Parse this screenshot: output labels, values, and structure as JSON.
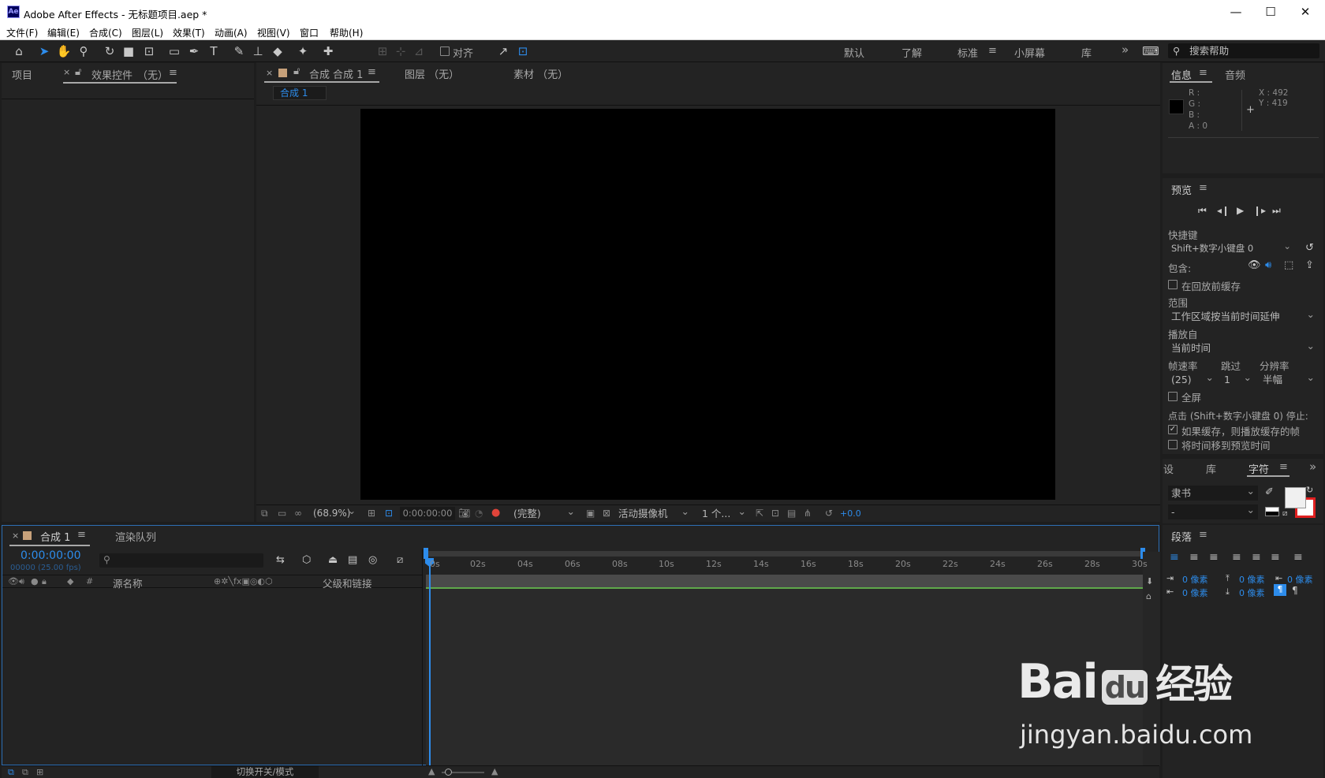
{
  "app": {
    "logo": "Ae",
    "title": "Adobe After Effects - 无标题项目.aep *"
  },
  "window_controls": {
    "minimize": "—",
    "maximize": "☐",
    "close": "✕"
  },
  "menu": [
    "文件(F)",
    "编辑(E)",
    "合成(C)",
    "图层(L)",
    "效果(T)",
    "动画(A)",
    "视图(V)",
    "窗口",
    "帮助(H)"
  ],
  "toolbar": {
    "align_label": "对齐",
    "workspaces": [
      "默认",
      "了解",
      "标准",
      "小屏幕",
      "库"
    ],
    "active_workspace": "标准",
    "more": "»",
    "search_placeholder": "搜索帮助"
  },
  "project_panel": {
    "tab_project": "项目",
    "tab_effects": "效果控件",
    "effects_target": "（无）"
  },
  "viewer": {
    "tab_comp_prefix": "合成",
    "tab_comp_name": "合成 1",
    "tab_layer": "图层 （无）",
    "tab_footage": "素材 （无）",
    "breadcrumb": "合成 1",
    "zoom": "(68.9%)",
    "timecode": "0:00:00:00",
    "resolution": "(完整)",
    "camera": "活动摄像机",
    "views": "1 个...",
    "exposure": "+0.0"
  },
  "info_panel": {
    "tab_info": "信息",
    "tab_audio": "音频",
    "r": "R :",
    "g": "G :",
    "b": "B :",
    "a": "A : 0",
    "x": "X : 492",
    "y": "Y : 419"
  },
  "preview_panel": {
    "title": "预览",
    "shortcut_label": "快捷键",
    "shortcut_value": "Shift+数字小键盘 0",
    "include_label": "包含:",
    "cache_before": "在回放前缓存",
    "range_label": "范围",
    "range_value": "工作区域按当前时间延伸",
    "play_from_label": "播放自",
    "play_from_value": "当前时间",
    "frame_rate_label": "帧速率",
    "skip_label": "跳过",
    "resolution_label": "分辨率",
    "frame_rate_value": "(25)",
    "skip_value": "1",
    "resolution_value": "半幅",
    "fullscreen": "全屏",
    "stop_label": "点击 (Shift+数字小键盘 0) 停止:",
    "if_cached": "如果缓存，则播放缓存的帧",
    "move_time": "将时间移到预览时间",
    "if_cached_checked": true
  },
  "character_panel": {
    "tab_settings": "设",
    "tab_library": "库",
    "tab_character": "字符",
    "font": "隶书",
    "style": "-",
    "more": "»"
  },
  "paragraph_panel": {
    "title": "段落",
    "indent_values": [
      "0 像素",
      "0 像素",
      "0 像素",
      "0 像素",
      "0 像素"
    ]
  },
  "timeline": {
    "tab_comp": "合成 1",
    "tab_render": "渲染队列",
    "timecode": "0:00:00:00",
    "fps": "00000 (25.00 fps)",
    "search_placeholder": "",
    "col_source": "源名称",
    "col_parent": "父级和链接",
    "col_hash": "#",
    "ticks": [
      "0s",
      "02s",
      "04s",
      "06s",
      "08s",
      "10s",
      "12s",
      "14s",
      "16s",
      "18s",
      "20s",
      "22s",
      "24s",
      "26s",
      "28s",
      "30s"
    ],
    "footer_toggle": "切换开关/模式"
  },
  "watermark": {
    "brand": "Bai",
    "brand2": "du",
    "jy": "经验",
    "url": "jingyan.baidu.com"
  }
}
